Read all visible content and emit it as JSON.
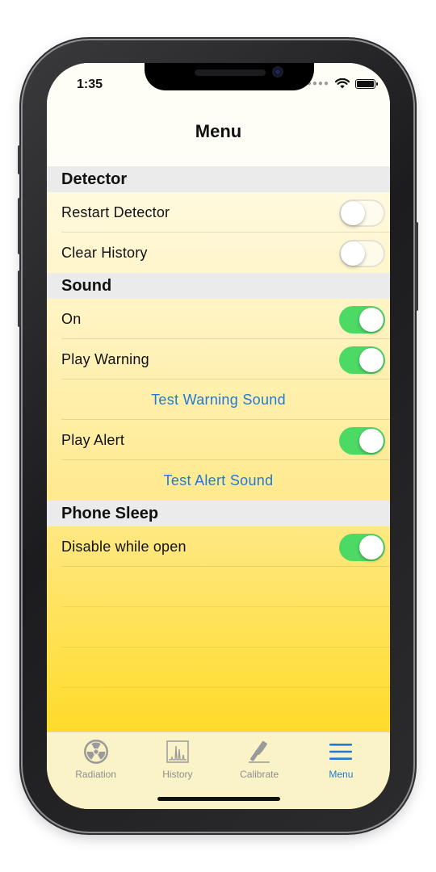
{
  "status_bar": {
    "time": "1:35"
  },
  "nav": {
    "title": "Menu"
  },
  "sections": [
    {
      "header": "Detector",
      "rows": [
        {
          "label": "Restart Detector",
          "type": "toggle",
          "on": false
        },
        {
          "label": "Clear History",
          "type": "toggle",
          "on": false
        }
      ]
    },
    {
      "header": "Sound",
      "rows": [
        {
          "label": "On",
          "type": "toggle",
          "on": true
        },
        {
          "label": "Play Warning",
          "type": "toggle",
          "on": true
        },
        {
          "label": "Test Warning Sound",
          "type": "link"
        },
        {
          "label": "Play Alert",
          "type": "toggle",
          "on": true
        },
        {
          "label": "Test Alert Sound",
          "type": "link"
        }
      ]
    },
    {
      "header": "Phone Sleep",
      "rows": [
        {
          "label": "Disable while open",
          "type": "toggle",
          "on": true
        }
      ]
    }
  ],
  "tabs": [
    {
      "label": "Radiation",
      "icon": "radiation-icon",
      "active": false
    },
    {
      "label": "History",
      "icon": "history-chart-icon",
      "active": false
    },
    {
      "label": "Calibrate",
      "icon": "calibrate-tool-icon",
      "active": false
    },
    {
      "label": "Menu",
      "icon": "menu-icon",
      "active": true
    }
  ],
  "colors": {
    "accent": "#1f7ad6",
    "toggle_on": "#4cd964",
    "section_header": "#ebebeb"
  }
}
